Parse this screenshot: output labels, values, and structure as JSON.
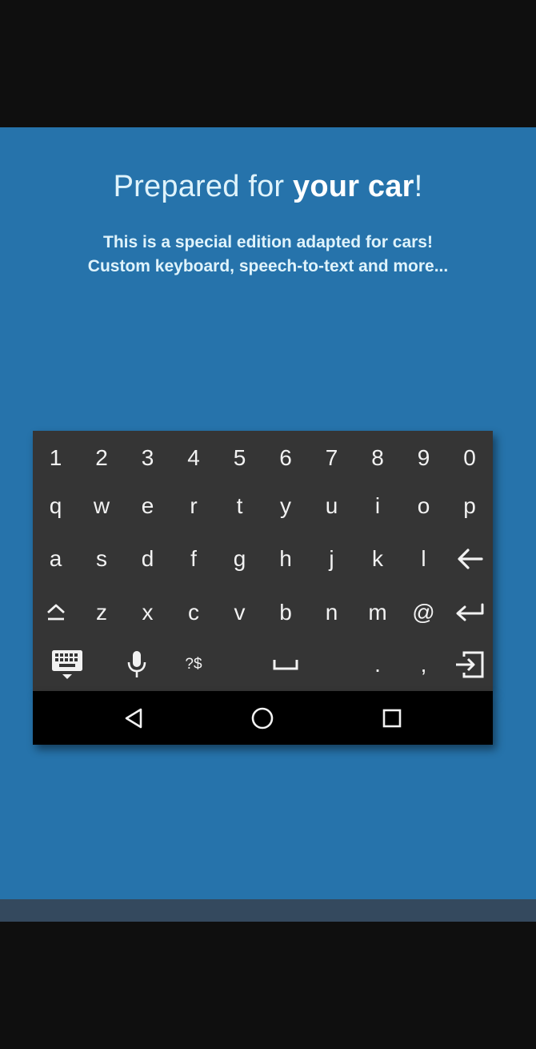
{
  "title": {
    "prefix": "Prepared for ",
    "bold": "your car",
    "suffix": "!"
  },
  "subtitle": {
    "line1": "This is a special edition adapted for cars!",
    "line2": "Custom keyboard, speech-to-text and more..."
  },
  "keyboard": {
    "row1": [
      "1",
      "2",
      "3",
      "4",
      "5",
      "6",
      "7",
      "8",
      "9",
      "0"
    ],
    "row2": [
      "q",
      "w",
      "e",
      "r",
      "t",
      "y",
      "u",
      "i",
      "o",
      "p"
    ],
    "row3": [
      "a",
      "s",
      "d",
      "f",
      "g",
      "h",
      "j",
      "k",
      "l"
    ],
    "row4": [
      "z",
      "x",
      "c",
      "v",
      "b",
      "n",
      "m",
      "@"
    ],
    "row5": {
      "symbols": "?$",
      "period": ".",
      "comma": ","
    }
  },
  "icons": {
    "backspace": "backspace-arrow-icon",
    "shift": "shift-icon",
    "enter": "enter-icon",
    "keyboard_switch": "keyboard-hide-icon",
    "mic": "microphone-icon",
    "space": "space-bar-icon",
    "exit": "exit-icon",
    "nav_back": "back-triangle-icon",
    "nav_home": "home-circle-icon",
    "nav_recents": "recents-square-icon"
  },
  "colors": {
    "panel_bg": "#2673ab",
    "keyboard_bg": "#353535",
    "text_light": "#dff3fb",
    "navbar_bg": "#000000",
    "strip": "#34495e"
  }
}
